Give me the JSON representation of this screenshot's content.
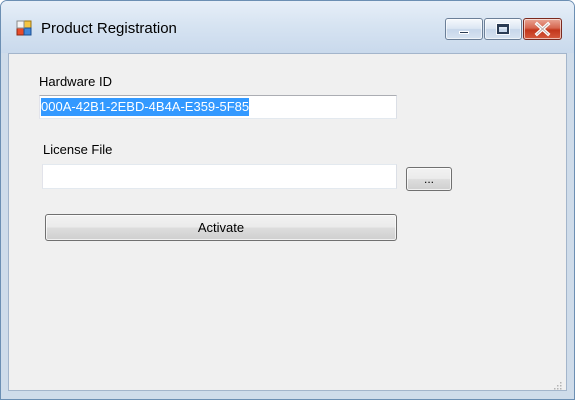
{
  "window": {
    "title": "Product Registration"
  },
  "form": {
    "hardware_id": {
      "label": "Hardware ID",
      "value": "000A-42B1-2EBD-4B4A-E359-5F85"
    },
    "license_file": {
      "label": "License File",
      "value": "",
      "browse_label": "..."
    },
    "activate_label": "Activate"
  },
  "colors": {
    "selection": "#3399ff",
    "client_background": "#f0f0f0",
    "close_button": "#c2361b"
  },
  "icons": {
    "app": "app-icon",
    "minimize": "minimize-icon",
    "maximize": "maximize-icon",
    "close": "close-icon",
    "resize_grip": "resize-grip-icon"
  }
}
